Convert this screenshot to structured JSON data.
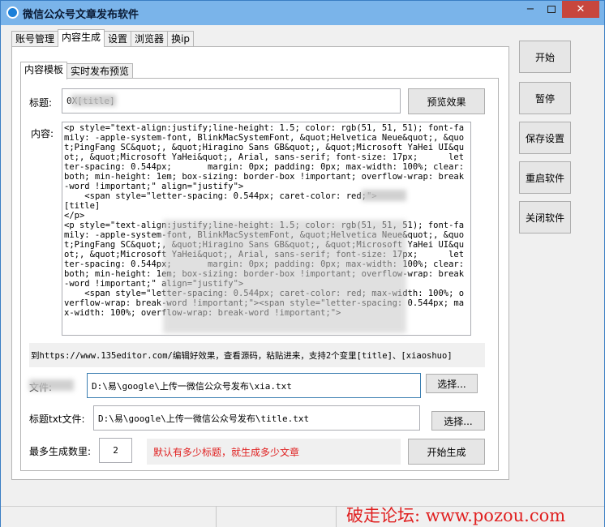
{
  "window": {
    "title": "微信公众号文章发布软件",
    "minimize": "−",
    "close": "✕"
  },
  "tabs": [
    "账号管理",
    "内容生成",
    "设置",
    "浏览器",
    "换ip"
  ],
  "active_tab": "内容生成",
  "inner_tabs": [
    "内容模板",
    "实时发布预览"
  ],
  "active_inner_tab": "内容模板",
  "form": {
    "title_label": "标题:",
    "title_value": "0X[title]",
    "preview_button": "预览效果",
    "content_label": "内容:",
    "content_value": "<p style=\"text-align:justify;line-height: 1.5; color: rgb(51, 51, 51); font-family: -apple-system-font, BlinkMacSystemFont, &quot;Helvetica Neue&quot;, &quot;PingFang SC&quot;, &quot;Hiragino Sans GB&quot;, &quot;Microsoft YaHei UI&quot;, &quot;Microsoft YaHei&quot;, Arial, sans-serif; font-size: 17px;      letter-spacing: 0.544px;       margin: 0px; padding: 0px; max-width: 100%; clear: both; min-height: 1em; box-sizing: border-box !important; overflow-wrap: break-word !important;\" align=\"justify\">\n    <span style=\"letter-spacing: 0.544px; caret-color: red;\">\n[title]\n</p>\n<p style=\"text-align:justify;line-height: 1.5; color: rgb(51, 51, 51); font-family: -apple-system-font, BlinkMacSystemFont, &quot;Helvetica Neue&quot;, &quot;PingFang SC&quot;, &quot;Hiragino Sans GB&quot;, &quot;Microsoft YaHei UI&quot;, &quot;Microsoft YaHei&quot;, Arial, sans-serif; font-size: 17px;      letter-spacing: 0.544px;       margin: 0px; padding: 0px; max-width: 100%; clear: both; min-height: 1em; box-sizing: border-box !important; overflow-wrap: break-word !important;\" align=\"justify\">\n    <span style=\"letter-spacing: 0.544px; caret-color: red; max-width: 100%; overflow-wrap: break-word !important;\"><span style=\"letter-spacing: 0.544px; max-width: 100%; overflow-wrap: break-word !important;\">",
    "hint_text": "到https://www.135editor.com/编辑好效果，查看源码，粘贴进来，支持2个变里[title]、[xiaoshuo]",
    "xiaoshuo_label": "文件:",
    "xiaoshuo_path": "D:\\易\\google\\上传一微信公众号发布\\xia.txt",
    "select_button_1": "选择...",
    "title_file_label": "标题txt文件:",
    "title_file_path": "D:\\易\\google\\上传一微信公众号发布\\title.txt",
    "select_button_2": "选择...",
    "max_label": "最多生成数里:",
    "max_value": "2",
    "note": "默认有多少标题，就生成多少文章",
    "generate_button": "开始生成"
  },
  "side_buttons": {
    "start": "开始",
    "pause": "暂停",
    "save": "保存设置",
    "restart": "重启软件",
    "close_app": "关闭软件"
  },
  "watermark": "破走论坛: www.pozou.com",
  "colors": {
    "titlebar": "#7ab4ea",
    "close": "#c7463d",
    "note": "#e02020"
  }
}
